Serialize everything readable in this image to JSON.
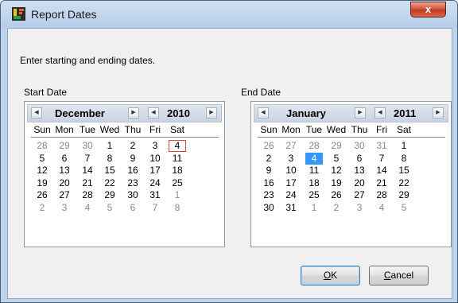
{
  "window": {
    "title": "Report Dates",
    "close_label": "x"
  },
  "instruction": "Enter starting and ending dates.",
  "start": {
    "label": "Start Date",
    "month": "December",
    "year": "2010",
    "selected": "4",
    "weekdays": [
      "Sun",
      "Mon",
      "Tue",
      "Wed",
      "Thu",
      "Fri",
      "Sat"
    ],
    "weeks": [
      [
        [
          "28",
          1
        ],
        [
          "29",
          1
        ],
        [
          "30",
          1
        ],
        [
          "1",
          0
        ],
        [
          "2",
          0
        ],
        [
          "3",
          0
        ],
        [
          "4",
          0
        ]
      ],
      [
        [
          "5",
          0
        ],
        [
          "6",
          0
        ],
        [
          "7",
          0
        ],
        [
          "8",
          0
        ],
        [
          "9",
          0
        ],
        [
          "10",
          0
        ],
        [
          "11",
          0
        ]
      ],
      [
        [
          "12",
          0
        ],
        [
          "13",
          0
        ],
        [
          "14",
          0
        ],
        [
          "15",
          0
        ],
        [
          "16",
          0
        ],
        [
          "17",
          0
        ],
        [
          "18",
          0
        ]
      ],
      [
        [
          "19",
          0
        ],
        [
          "20",
          0
        ],
        [
          "21",
          0
        ],
        [
          "22",
          0
        ],
        [
          "23",
          0
        ],
        [
          "24",
          0
        ],
        [
          "25",
          0
        ]
      ],
      [
        [
          "26",
          0
        ],
        [
          "27",
          0
        ],
        [
          "28",
          0
        ],
        [
          "29",
          0
        ],
        [
          "30",
          0
        ],
        [
          "31",
          0
        ],
        [
          "1",
          1
        ]
      ],
      [
        [
          "2",
          1
        ],
        [
          "3",
          1
        ],
        [
          "4",
          1
        ],
        [
          "5",
          1
        ],
        [
          "6",
          1
        ],
        [
          "7",
          1
        ],
        [
          "8",
          1
        ]
      ]
    ]
  },
  "end": {
    "label": "End Date",
    "month": "January",
    "year": "2011",
    "selected": "4",
    "weekdays": [
      "Sun",
      "Mon",
      "Tue",
      "Wed",
      "Thu",
      "Fri",
      "Sat"
    ],
    "weeks": [
      [
        [
          "26",
          1
        ],
        [
          "27",
          1
        ],
        [
          "28",
          1
        ],
        [
          "29",
          1
        ],
        [
          "30",
          1
        ],
        [
          "31",
          1
        ],
        [
          "1",
          0
        ]
      ],
      [
        [
          "2",
          0
        ],
        [
          "3",
          0
        ],
        [
          "4",
          0
        ],
        [
          "5",
          0
        ],
        [
          "6",
          0
        ],
        [
          "7",
          0
        ],
        [
          "8",
          0
        ]
      ],
      [
        [
          "9",
          0
        ],
        [
          "10",
          0
        ],
        [
          "11",
          0
        ],
        [
          "12",
          0
        ],
        [
          "13",
          0
        ],
        [
          "14",
          0
        ],
        [
          "15",
          0
        ]
      ],
      [
        [
          "16",
          0
        ],
        [
          "17",
          0
        ],
        [
          "18",
          0
        ],
        [
          "19",
          0
        ],
        [
          "20",
          0
        ],
        [
          "21",
          0
        ],
        [
          "22",
          0
        ]
      ],
      [
        [
          "23",
          0
        ],
        [
          "24",
          0
        ],
        [
          "25",
          0
        ],
        [
          "26",
          0
        ],
        [
          "27",
          0
        ],
        [
          "28",
          0
        ],
        [
          "29",
          0
        ]
      ],
      [
        [
          "30",
          0
        ],
        [
          "31",
          0
        ],
        [
          "1",
          1
        ],
        [
          "2",
          1
        ],
        [
          "3",
          1
        ],
        [
          "4",
          1
        ],
        [
          "5",
          1
        ]
      ]
    ]
  },
  "buttons": {
    "ok_mnemonic": "O",
    "ok_rest": "K",
    "cancel_mnemonic": "C",
    "cancel_rest": "ancel"
  },
  "icons": [
    "app-icon",
    "close-icon",
    "left-arrow-icon",
    "right-arrow-icon"
  ]
}
